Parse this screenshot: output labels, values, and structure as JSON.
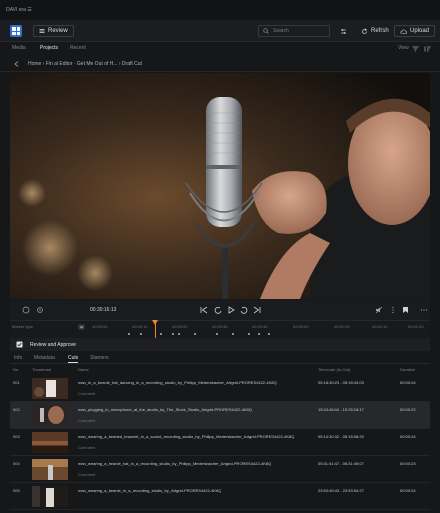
{
  "titlebar": {
    "title": "DAVI era ☰"
  },
  "header": {
    "review_label": "Review",
    "search_placeholder": "Search",
    "refresh_label": "Refrsh",
    "upload_label": "Upload"
  },
  "nav": {
    "tabs": [
      "Media",
      "Projects",
      "Recent"
    ],
    "active": "Projects",
    "view_label": "View"
  },
  "breadcrumb": {
    "path": "Home › Fin al Editor · Get Me Out of H... › Draft Cut"
  },
  "controls": {
    "timecode": "00:30:16:13"
  },
  "ruler": {
    "label": "Marker type",
    "ticks": [
      "10:00:00",
      "00:00:10",
      "00:00:20",
      "00:00:30",
      "00:00:40",
      "00:00:50",
      "00:01:00",
      "00:01:10",
      "00:01:20"
    ]
  },
  "section": {
    "title": "Review and Approve"
  },
  "tabs": {
    "items": [
      "Info",
      "Metadata",
      "Cuts",
      "Stamers"
    ],
    "active": "Cuts"
  },
  "table": {
    "columns": [
      "No.",
      "Thumbnail",
      "Name",
      "Timecode (In-Out)",
      "Duration"
    ],
    "comment_label": "Comment",
    "rows": [
      {
        "no": "001",
        "name": "man_in_a_beanie_hat_dancing_in_a_recording_studio_by_Philipp_Medersbacher_Artgrid-PRORES4422-4K8Q",
        "tc": "05:18:30:23 - 05:18:43:03",
        "dur": "00:00:24"
      },
      {
        "no": "002",
        "name": "man_plugging_in_microphone_at_the_studio_by_The_Stock_Studio_Artgrid-PRORES4422-4K8Q",
        "tc": "15:24:46:04 - 15:25:18:17",
        "dur": "00:00:22"
      },
      {
        "no": "003",
        "name": "man_wearing_a_beaded_bracelet_in_a_sound_recording_studio_by_Philipp_Medersbacher_Artgrid-PRORES4422-4K8Q",
        "tc": "05:14:30:32 - 05:15:08:20",
        "dur": "00:00:24"
      },
      {
        "no": "004",
        "name": "man_wearing_a_beanie_hat_in_a_recording_studio_by_Philipp_Medersbacher_Artgrid-PRORES4422-4K8Q",
        "tc": "05:31:41:47 - 05:31:45:07",
        "dur": "00:00:23"
      },
      {
        "no": "005",
        "name": "man_wearing_a_beanie_in_a_recording_studio_by_Artgrid-PRORES4422-4K8Q",
        "tc": "23:53:49:43 - 23:53:54:27",
        "dur": "00:00:24"
      }
    ]
  },
  "colors": {
    "accent": "#2f6fd6",
    "playhead": "#e98a2c"
  }
}
